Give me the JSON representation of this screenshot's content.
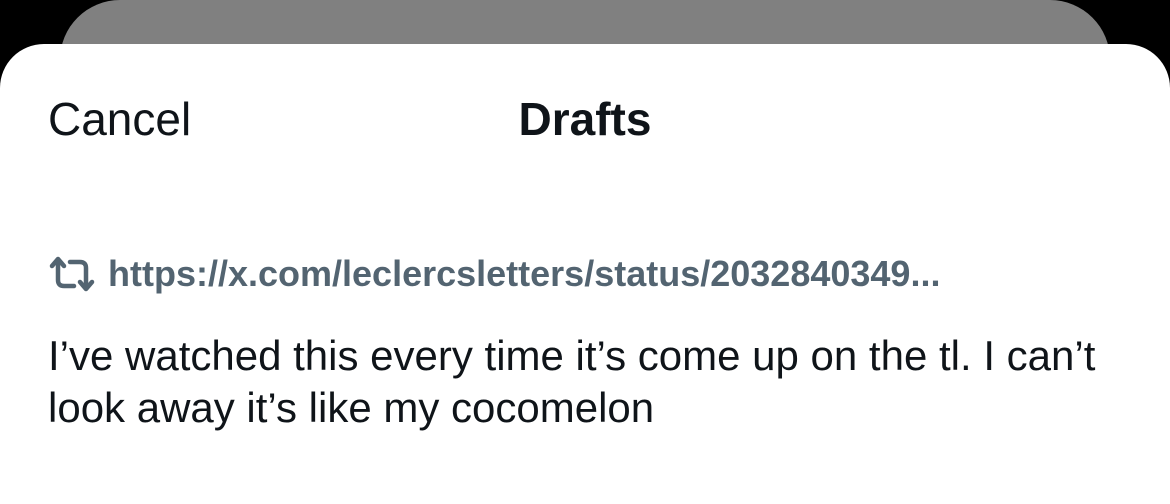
{
  "header": {
    "cancel_label": "Cancel",
    "title": "Drafts"
  },
  "drafts": [
    {
      "quote_icon": "repost-icon",
      "quote_url": "https://x.com/leclercsletters/status/2032840349...",
      "text": "I’ve watched this every time it’s come up on the tl. I can’t look away it’s like my cocomelon"
    }
  ],
  "colors": {
    "text_primary": "#0f1419",
    "text_secondary": "#536471",
    "sheet_background": "#ffffff",
    "backdrop": "#000000",
    "underlying_sheet": "#808080"
  }
}
